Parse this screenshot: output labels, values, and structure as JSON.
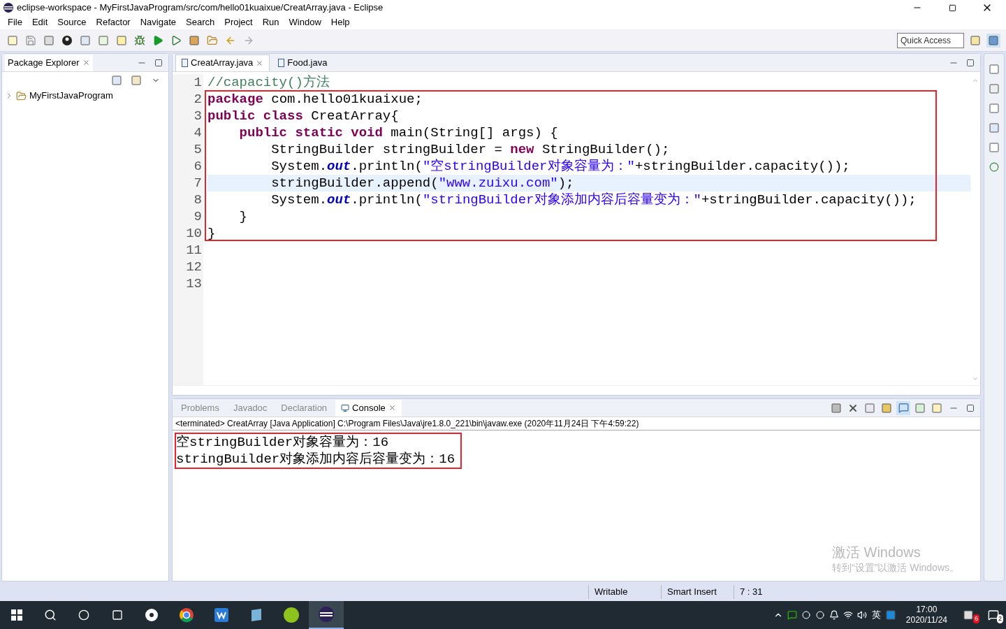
{
  "window": {
    "title": "eclipse-workspace - MyFirstJavaProgram/src/com/hello01kuaixue/CreatArray.java - Eclipse"
  },
  "menu": [
    "File",
    "Edit",
    "Source",
    "Refactor",
    "Navigate",
    "Search",
    "Project",
    "Run",
    "Window",
    "Help"
  ],
  "quick_access": {
    "placeholder": "Quick Access"
  },
  "package_explorer": {
    "title": "Package Explorer",
    "tree": [
      {
        "label": "MyFirstJavaProgram",
        "expanded": false
      }
    ]
  },
  "editor": {
    "tabs": [
      {
        "label": "CreatArray.java",
        "selected": true
      },
      {
        "label": "Food.java",
        "selected": false
      }
    ],
    "lines": [
      {
        "number": "1",
        "current": false,
        "tokens": [
          {
            "text": "//capacity()方法",
            "kind": "comment"
          }
        ]
      },
      {
        "number": "2",
        "current": false,
        "tokens": [
          {
            "text": "package",
            "kind": "keyword"
          },
          {
            "text": " com.hello01kuaixue;",
            "kind": "plain"
          }
        ]
      },
      {
        "number": "3",
        "current": false,
        "tokens": [
          {
            "text": "public class",
            "kind": "keyword"
          },
          {
            "text": " CreatArray{",
            "kind": "plain"
          }
        ]
      },
      {
        "number": "4",
        "current": false,
        "tokens": [
          {
            "text": "    public static void",
            "kind": "keyword"
          },
          {
            "text": " main(String[] args) {",
            "kind": "plain"
          }
        ]
      },
      {
        "number": "5",
        "current": false,
        "tokens": [
          {
            "text": "        StringBuilder stringBuilder = ",
            "kind": "plain"
          },
          {
            "text": "new",
            "kind": "keyword"
          },
          {
            "text": " StringBuilder();",
            "kind": "plain"
          }
        ]
      },
      {
        "number": "6",
        "current": false,
        "tokens": [
          {
            "text": "        System.",
            "kind": "plain"
          },
          {
            "text": "out",
            "kind": "field"
          },
          {
            "text": ".println(",
            "kind": "plain"
          },
          {
            "text": "\"空stringBuilder对象容量为：\"",
            "kind": "string"
          },
          {
            "text": "+stringBuilder.capacity());",
            "kind": "plain"
          }
        ]
      },
      {
        "number": "7",
        "current": true,
        "tokens": [
          {
            "text": "        stringBuilder.append(",
            "kind": "plain"
          },
          {
            "text": "\"www.zuixu.com\"",
            "kind": "string"
          },
          {
            "text": ");",
            "kind": "plain"
          }
        ]
      },
      {
        "number": "8",
        "current": false,
        "tokens": [
          {
            "text": "        System.",
            "kind": "plain"
          },
          {
            "text": "out",
            "kind": "field"
          },
          {
            "text": ".println(",
            "kind": "plain"
          },
          {
            "text": "\"stringBuilder对象添加内容后容量变为：\"",
            "kind": "string"
          },
          {
            "text": "+stringBuilder.capacity());",
            "kind": "plain"
          }
        ]
      },
      {
        "number": "9",
        "current": false,
        "tokens": [
          {
            "text": "    }",
            "kind": "plain"
          }
        ]
      },
      {
        "number": "10",
        "current": false,
        "tokens": [
          {
            "text": "}",
            "kind": "plain"
          }
        ]
      },
      {
        "number": "11",
        "current": false
      },
      {
        "number": "12",
        "current": false
      },
      {
        "number": "13",
        "current": false
      }
    ]
  },
  "bottom_panel": {
    "tabs": [
      {
        "label": "Problems",
        "selected": false
      },
      {
        "label": "Javadoc",
        "selected": false
      },
      {
        "label": "Declaration",
        "selected": false
      },
      {
        "label": "Console",
        "selected": true
      }
    ],
    "console_header": "<terminated> CreatArray [Java Application] C:\\Program Files\\Java\\jre1.8.0_221\\bin\\javaw.exe (2020年11月24日 下午4:59:22)",
    "output": [
      "空stringBuilder对象容量为：16",
      "stringBuilder对象添加内容后容量变为：16"
    ]
  },
  "activation": {
    "title": "激活 Windows",
    "text": "转到“设置”以激活 Windows。"
  },
  "status_bar": [
    "Writable",
    "Smart Insert",
    "7 : 31"
  ],
  "taskbar": {
    "ime": "英",
    "time": "17:00",
    "date": "2020/11/24",
    "notification_badge": "6",
    "action_badge": "2"
  }
}
